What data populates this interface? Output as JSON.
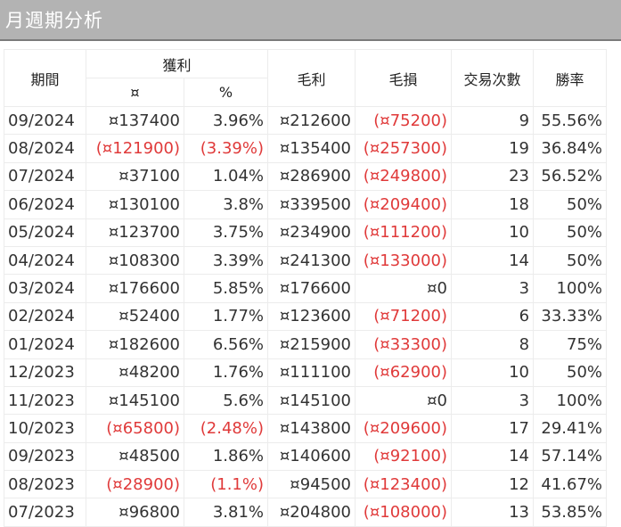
{
  "title": "月週期分析",
  "headers": {
    "period": "期間",
    "profit": "獲利",
    "profit_amount": "¤",
    "profit_pct": "%",
    "gross_profit": "毛利",
    "gross_loss": "毛損",
    "trades": "交易次數",
    "win_rate": "勝率"
  },
  "colors": {
    "negative": "#e03a3a",
    "title_bg": "#b3b3b3"
  },
  "rows": [
    {
      "period": "09/2024",
      "profit": "¤137400",
      "pct": "3.96%",
      "gp": "¤212600",
      "gl": "(¤75200)",
      "trades": "9",
      "win": "55.56%",
      "neg_profit": false,
      "neg_gl": true
    },
    {
      "period": "08/2024",
      "profit": "(¤121900)",
      "pct": "(3.39%)",
      "gp": "¤135400",
      "gl": "(¤257300)",
      "trades": "19",
      "win": "36.84%",
      "neg_profit": true,
      "neg_gl": true
    },
    {
      "period": "07/2024",
      "profit": "¤37100",
      "pct": "1.04%",
      "gp": "¤286900",
      "gl": "(¤249800)",
      "trades": "23",
      "win": "56.52%",
      "neg_profit": false,
      "neg_gl": true
    },
    {
      "period": "06/2024",
      "profit": "¤130100",
      "pct": "3.8%",
      "gp": "¤339500",
      "gl": "(¤209400)",
      "trades": "18",
      "win": "50%",
      "neg_profit": false,
      "neg_gl": true
    },
    {
      "period": "05/2024",
      "profit": "¤123700",
      "pct": "3.75%",
      "gp": "¤234900",
      "gl": "(¤111200)",
      "trades": "10",
      "win": "50%",
      "neg_profit": false,
      "neg_gl": true
    },
    {
      "period": "04/2024",
      "profit": "¤108300",
      "pct": "3.39%",
      "gp": "¤241300",
      "gl": "(¤133000)",
      "trades": "14",
      "win": "50%",
      "neg_profit": false,
      "neg_gl": true
    },
    {
      "period": "03/2024",
      "profit": "¤176600",
      "pct": "5.85%",
      "gp": "¤176600",
      "gl": "¤0",
      "trades": "3",
      "win": "100%",
      "neg_profit": false,
      "neg_gl": false
    },
    {
      "period": "02/2024",
      "profit": "¤52400",
      "pct": "1.77%",
      "gp": "¤123600",
      "gl": "(¤71200)",
      "trades": "6",
      "win": "33.33%",
      "neg_profit": false,
      "neg_gl": true
    },
    {
      "period": "01/2024",
      "profit": "¤182600",
      "pct": "6.56%",
      "gp": "¤215900",
      "gl": "(¤33300)",
      "trades": "8",
      "win": "75%",
      "neg_profit": false,
      "neg_gl": true
    },
    {
      "period": "12/2023",
      "profit": "¤48200",
      "pct": "1.76%",
      "gp": "¤111100",
      "gl": "(¤62900)",
      "trades": "10",
      "win": "50%",
      "neg_profit": false,
      "neg_gl": true
    },
    {
      "period": "11/2023",
      "profit": "¤145100",
      "pct": "5.6%",
      "gp": "¤145100",
      "gl": "¤0",
      "trades": "3",
      "win": "100%",
      "neg_profit": false,
      "neg_gl": false
    },
    {
      "period": "10/2023",
      "profit": "(¤65800)",
      "pct": "(2.48%)",
      "gp": "¤143800",
      "gl": "(¤209600)",
      "trades": "17",
      "win": "29.41%",
      "neg_profit": true,
      "neg_gl": true
    },
    {
      "period": "09/2023",
      "profit": "¤48500",
      "pct": "1.86%",
      "gp": "¤140600",
      "gl": "(¤92100)",
      "trades": "14",
      "win": "57.14%",
      "neg_profit": false,
      "neg_gl": true
    },
    {
      "period": "08/2023",
      "profit": "(¤28900)",
      "pct": "(1.1%)",
      "gp": "¤94500",
      "gl": "(¤123400)",
      "trades": "12",
      "win": "41.67%",
      "neg_profit": true,
      "neg_gl": true
    },
    {
      "period": "07/2023",
      "profit": "¤96800",
      "pct": "3.81%",
      "gp": "¤204800",
      "gl": "(¤108000)",
      "trades": "13",
      "win": "53.85%",
      "neg_profit": false,
      "neg_gl": true
    }
  ]
}
